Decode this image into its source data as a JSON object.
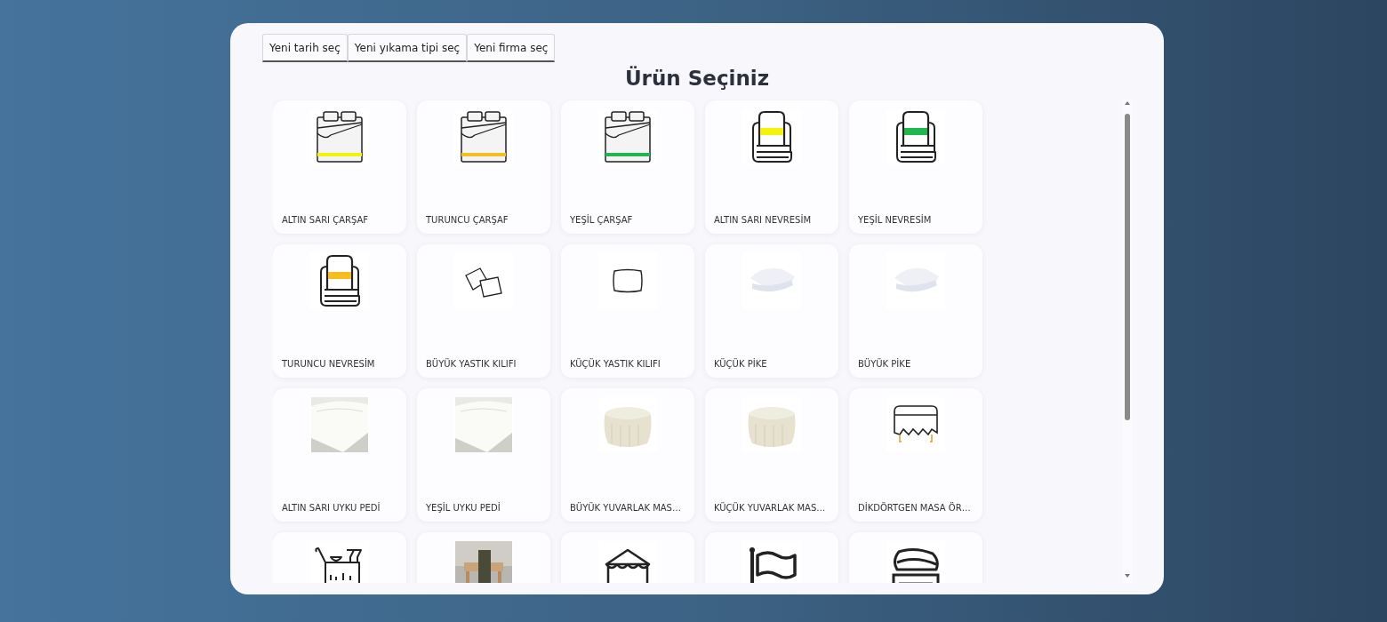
{
  "tabs": [
    {
      "label": "Yeni tarih seç"
    },
    {
      "label": "Yeni yıkama tipi seç"
    },
    {
      "label": "Yeni firma seç"
    }
  ],
  "title": "Ürün Seçiniz",
  "products": [
    {
      "label": "ALTIN SARI ÇARŞAF",
      "image": {
        "kind": "bed",
        "color": "#f4f40a"
      }
    },
    {
      "label": "TURUNCU ÇARŞAF",
      "image": {
        "kind": "bed",
        "color": "#f5bd1e"
      }
    },
    {
      "label": "YEŞİL ÇARŞAF",
      "image": {
        "kind": "bed",
        "color": "#1fb84f"
      }
    },
    {
      "label": "ALTIN SARI NEVRESİM",
      "image": {
        "kind": "blanket",
        "color": "#f4f40a"
      }
    },
    {
      "label": "YEŞİL NEVRESİM",
      "image": {
        "kind": "blanket",
        "color": "#1fb84f"
      }
    },
    {
      "label": "TURUNCU NEVRESİM",
      "image": {
        "kind": "blanket",
        "color": "#f5bd1e"
      }
    },
    {
      "label": "BÜYÜK YASTIK KILIFI",
      "image": {
        "kind": "pillows"
      }
    },
    {
      "label": "KÜÇÜK YASTIK KILIFI",
      "image": {
        "kind": "pillow"
      }
    },
    {
      "label": "KÜÇÜK PİKE",
      "image": {
        "kind": "picture"
      }
    },
    {
      "label": "BÜYÜK PİKE",
      "image": {
        "kind": "picture"
      }
    },
    {
      "label": "ALTIN SARI UYKU PEDİ",
      "image": {
        "kind": "picture"
      }
    },
    {
      "label": "YEŞİL UYKU PEDİ",
      "image": {
        "kind": "picture"
      }
    },
    {
      "label": "BÜYÜK YUVARLAK MAS…",
      "image": {
        "kind": "picture"
      }
    },
    {
      "label": "KÜÇÜK YUVARLAK MAS…",
      "image": {
        "kind": "picture"
      }
    },
    {
      "label": "DİKDÖRTGEN MASA ÖR…",
      "image": {
        "kind": "table"
      }
    },
    {
      "image": {
        "kind": "cart"
      }
    },
    {
      "image": {
        "kind": "picture"
      }
    },
    {
      "image": {
        "kind": "tent"
      }
    },
    {
      "image": {
        "kind": "flag"
      }
    },
    {
      "image": {
        "kind": "tablecloth"
      }
    }
  ]
}
